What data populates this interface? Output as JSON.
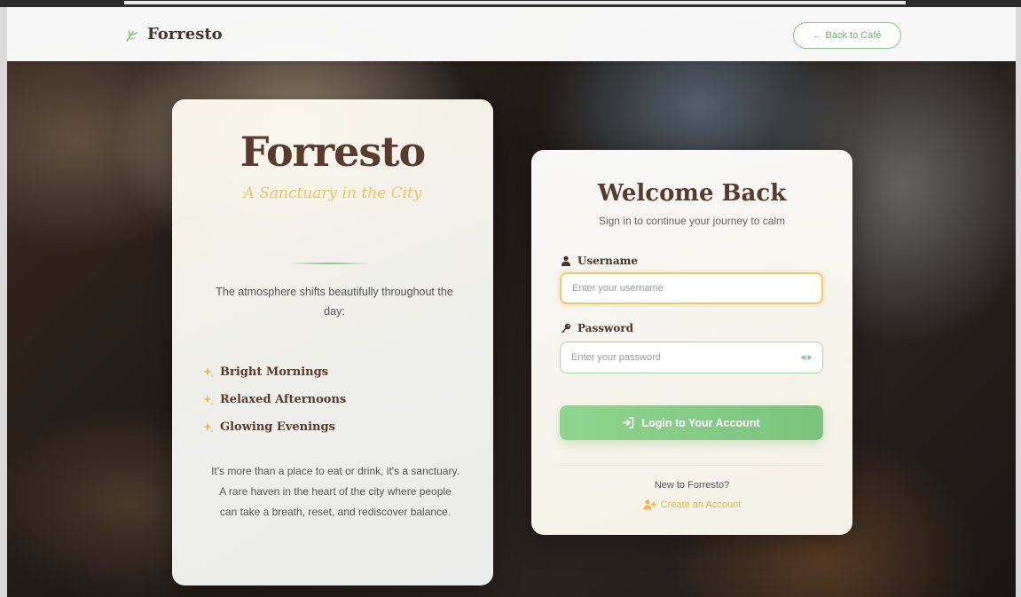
{
  "nav": {
    "brand": "Forresto",
    "back_label": "← Back to Café"
  },
  "left_card": {
    "title": "Forresto",
    "tagline": "A Sanctuary in the City",
    "description": "The atmosphere shifts beautifully throughout the day:",
    "features": [
      {
        "label": "Bright Mornings",
        "icon": "sparkle-icon"
      },
      {
        "label": "Relaxed Afternoons",
        "icon": "sparkle-icon"
      },
      {
        "label": "Glowing Evenings",
        "icon": "sparkle-icon"
      }
    ],
    "closing": "It's more than a place to eat or drink, it's a sanctuary. A rare haven in the heart of the city where people can take a breath, reset, and rediscover balance."
  },
  "login": {
    "title": "Welcome Back",
    "subtitle": "Sign in to continue your journey to calm",
    "username_label": "Username",
    "username_placeholder": "Enter your username",
    "username_value": "",
    "password_label": "Password",
    "password_placeholder": "Enter your password",
    "password_value": "",
    "submit_label": "Login to Your Account",
    "new_prompt": "New to Forresto?",
    "create_label": "Create an Account"
  },
  "colors": {
    "brand_brown": "#5a3a2c",
    "accent_green": "#7bc47e",
    "accent_gold": "#f1c36a"
  }
}
